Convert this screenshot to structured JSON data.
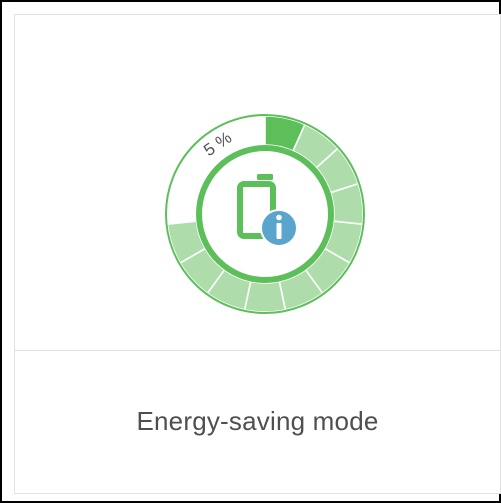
{
  "tile": {
    "label": "Energy-saving mode",
    "percent_text": "5 %",
    "battery_level_percent": 5,
    "segments_total": 15,
    "icon": "battery-info-icon",
    "colors": {
      "ring": "#5cbf5a",
      "segment_light": "#aedcaa",
      "segment_active": "#5cbf5a",
      "info_badge": "#5aa5cd",
      "label": "#4f4f4f"
    }
  }
}
